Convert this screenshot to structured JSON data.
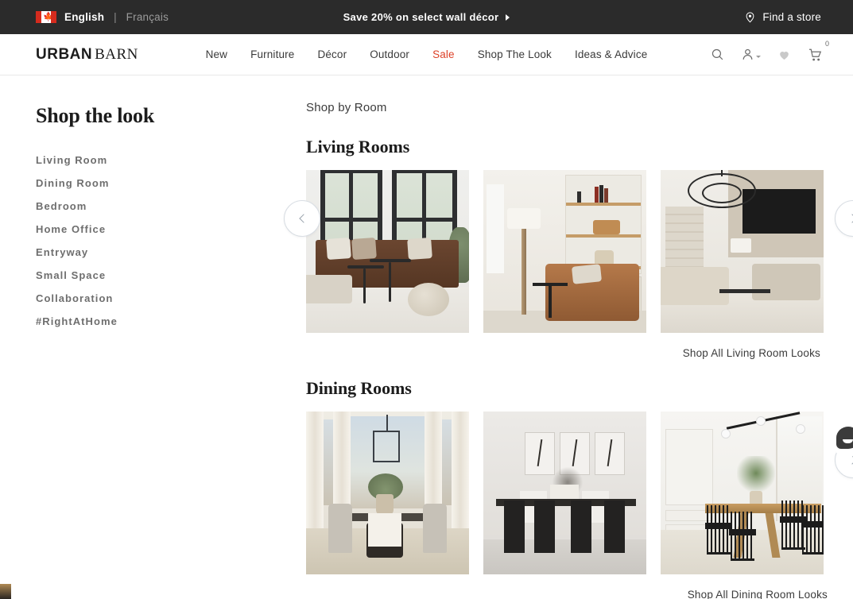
{
  "promo_bar": {
    "flag_icon": "canada-flag-icon",
    "lang_english": "English",
    "lang_separator": "|",
    "lang_french": "Français",
    "message": "Save 20% on select wall décor",
    "find_store": "Find a store",
    "find_store_icon": "map-pin-icon",
    "background": "#2b2b2b"
  },
  "header": {
    "logo_primary": "URBAN",
    "logo_secondary": "BARN",
    "nav": [
      {
        "label": "New",
        "sale": false
      },
      {
        "label": "Furniture",
        "sale": false
      },
      {
        "label": "Décor",
        "sale": false
      },
      {
        "label": "Outdoor",
        "sale": false
      },
      {
        "label": "Sale",
        "sale": true
      },
      {
        "label": "Shop The Look",
        "sale": false
      },
      {
        "label": "Ideas & Advice",
        "sale": false
      }
    ],
    "icons": {
      "search": "search-icon",
      "account": "user-account-icon",
      "wishlist": "heart-icon",
      "cart": "shopping-cart-icon",
      "cart_count": "0"
    },
    "sale_color": "#dd4128"
  },
  "sidebar": {
    "title": "Shop the look",
    "items": [
      {
        "label": "Living Room"
      },
      {
        "label": "Dining Room"
      },
      {
        "label": "Bedroom"
      },
      {
        "label": "Home Office"
      },
      {
        "label": "Entryway"
      },
      {
        "label": "Small Space"
      },
      {
        "label": "Collaboration"
      },
      {
        "label": "#RightAtHome"
      }
    ]
  },
  "main": {
    "eyebrow": "Shop by Room",
    "sections": [
      {
        "title": "Living Rooms",
        "shop_all": "Shop All Living Room Looks",
        "tiles": [
          {
            "alt": "living-room-leather-sofa-large-windows"
          },
          {
            "alt": "living-room-shelving-leather-armchair"
          },
          {
            "alt": "living-room-chandelier-stone-fireplace"
          }
        ]
      },
      {
        "title": "Dining Rooms",
        "shop_all": "Shop All Dining Room Looks",
        "tiles": [
          {
            "alt": "dining-room-sheer-curtains-lantern-pendant"
          },
          {
            "alt": "dining-room-black-table-wall-art"
          },
          {
            "alt": "dining-room-wood-table-black-spindle-chairs"
          }
        ]
      }
    ],
    "carousel": {
      "prev_label": "Previous",
      "next_label": "Next"
    }
  },
  "chat_widget": {
    "icon": "chat-bubble-icon"
  }
}
